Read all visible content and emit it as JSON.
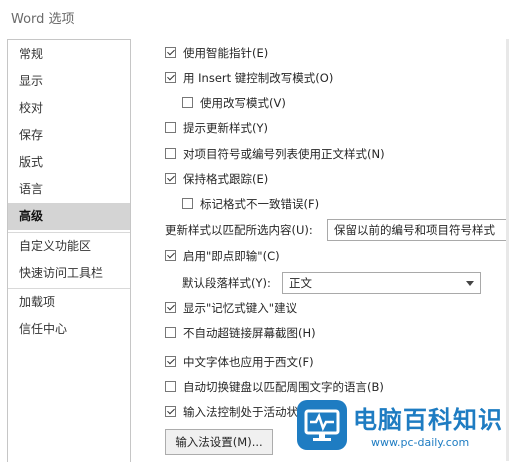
{
  "window": {
    "title": "Word 选项"
  },
  "sidebar": {
    "items": [
      {
        "label": "常规",
        "selected": false
      },
      {
        "label": "显示",
        "selected": false
      },
      {
        "label": "校对",
        "selected": false
      },
      {
        "label": "保存",
        "selected": false
      },
      {
        "label": "版式",
        "selected": false
      },
      {
        "label": "语言",
        "selected": false
      },
      {
        "label": "高级",
        "selected": true
      },
      {
        "label": "自定义功能区",
        "selected": false
      },
      {
        "label": "快速访问工具栏",
        "selected": false
      },
      {
        "label": "加载项",
        "selected": false
      },
      {
        "label": "信任中心",
        "selected": false
      }
    ]
  },
  "options": [
    {
      "label": "使用智能指针(E)",
      "checked": true
    },
    {
      "label": "用 Insert 键控制改写模式(O)",
      "checked": true
    },
    {
      "label": "使用改写模式(V)",
      "checked": false
    },
    {
      "label": "提示更新样式(Y)",
      "checked": false
    },
    {
      "label": "对项目符号或编号列表使用正文样式(N)",
      "checked": false
    },
    {
      "label": "保持格式跟踪(E)",
      "checked": true
    },
    {
      "label": "标记格式不一致错误(F)",
      "checked": false
    },
    {
      "label": "启用\"即点即输\"(C)",
      "checked": true
    },
    {
      "label": "显示\"记忆式键入\"建议",
      "checked": true
    },
    {
      "label": "不自动超链接屏幕截图(H)",
      "checked": false
    },
    {
      "label": "中文字体也应用于西文(F)",
      "checked": true
    },
    {
      "label": "自动切换键盘以匹配周围文字的语言(B)",
      "checked": false
    },
    {
      "label": "输入法控制处于活动状态",
      "checked": true
    }
  ],
  "style_update": {
    "label": "更新样式以匹配所选内容(U):",
    "value": "保留以前的编号和项目符号样式"
  },
  "default_paragraph": {
    "label": "默认段落样式(Y):",
    "value": "正文"
  },
  "ime_button": {
    "label": "输入法设置(M)..."
  },
  "watermark": {
    "title": "电脑百科知识",
    "url": "www.pc-daily.com"
  }
}
